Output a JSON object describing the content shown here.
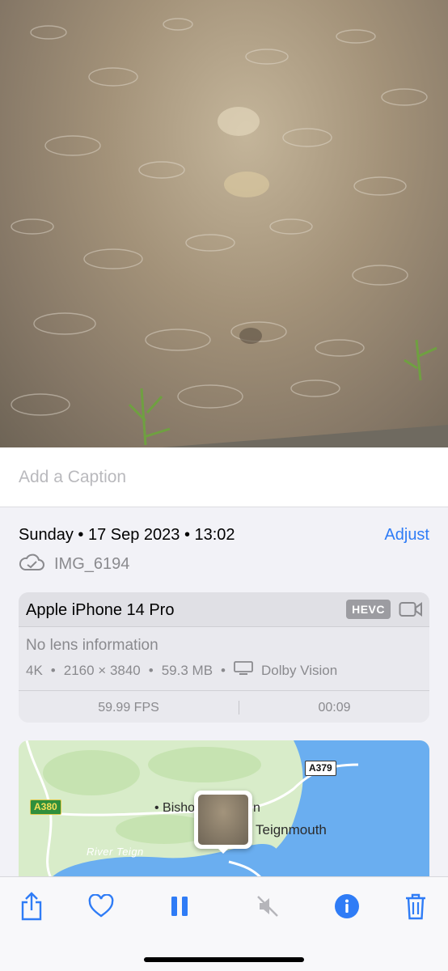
{
  "caption": {
    "placeholder": "Add a Caption"
  },
  "info": {
    "datetime": "Sunday • 17 Sep 2023 • 13:02",
    "adjust_label": "Adjust",
    "filename": "IMG_6194",
    "file_icon": "cloud-icon"
  },
  "device_card": {
    "device": "Apple iPhone 14 Pro",
    "codec": "HEVC",
    "lens": "No lens information",
    "resolution": "4K",
    "dimensions": "2160 × 3840",
    "size": "59.3 MB",
    "hdr": "Dolby Vision",
    "fps": "59.99 FPS",
    "duration": "00:09"
  },
  "map": {
    "place_label": "Teignmouth",
    "town_label_partial": "Bisho",
    "town_label_partial_end": "n",
    "river_label": "River Teign",
    "road_a380": "A380",
    "road_a379": "A379"
  },
  "toolbar": {
    "accent": "#2f7cf6",
    "icons": [
      "share-icon",
      "heart-icon",
      "pause-icon",
      "mute-icon",
      "info-icon",
      "trash-icon"
    ]
  }
}
